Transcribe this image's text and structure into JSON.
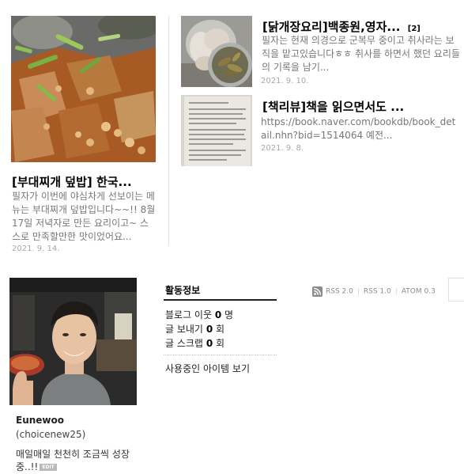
{
  "featured_post": {
    "title": "[부대찌개 덮밥] 한국...",
    "excerpt": "필자가 이번에 야심차게 선보이는 메뉴는 부대찌개 덮밥입니다~~!! 8월17일 저녁자로 만든 요리이고~ 스스로 만족할만한 맛이었어요...",
    "date": "2021. 9. 14."
  },
  "side_posts": [
    {
      "title": "[닭개장요리]백종원,영자...",
      "comment_count": "[2]",
      "excerpt": "필자는 현재 의경으로 군복무 중이고 취사라는 보직을 맡고있습니다ㅎㅎ 취사를 하면서 했던 요리들의 기록을 남기...",
      "date": "2021. 9. 10."
    },
    {
      "title": "[책리뷰]책을 읽으면서도 ...",
      "excerpt": "https://book.naver.com/bookdb/book_detail.nhn?bid=1514064 예전...",
      "date": "2021. 9. 8."
    }
  ],
  "profile": {
    "name": "Eunewoo",
    "user_id": "(choicenew25)",
    "bio": "매일매일 천천히 조금씩 성장중..!!",
    "edit_label": "EDIT"
  },
  "activity": {
    "heading": "활동정보",
    "neighbors_label": "블로그 이웃",
    "neighbors_value": "0",
    "neighbors_unit": "명",
    "sent_label": "글 보내기",
    "sent_value": "0",
    "sent_unit": "회",
    "scrap_label": "글 스크랩",
    "scrap_value": "0",
    "scrap_unit": "회",
    "items_link": "사용중인 아이템 보기"
  },
  "feeds": {
    "rss2": "RSS 2.0",
    "rss1": "RSS 1.0",
    "atom": "ATOM 0.3"
  },
  "colors": {
    "title": "#000000",
    "excerpt": "#777777",
    "date": "#a8a8a8",
    "rss_icon": "#8c8c8c"
  }
}
